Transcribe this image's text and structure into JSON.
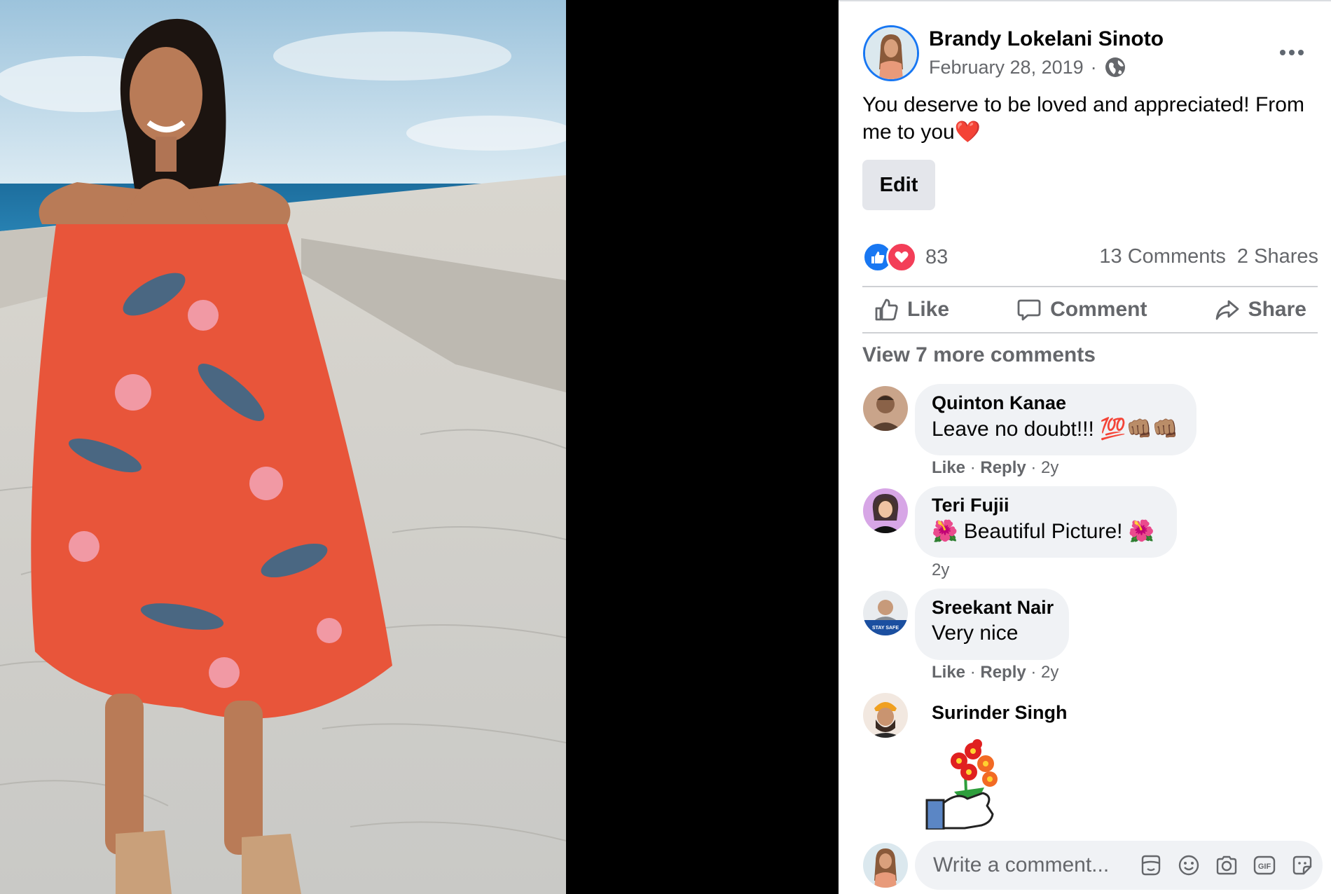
{
  "post": {
    "author": "Brandy Lokelani Sinoto",
    "date": "February 28, 2019",
    "date_separator": "·",
    "privacy_icon": "globe-icon",
    "text": "You deserve to be loved and appreciated! From me to you",
    "text_emoji": "❤️",
    "edit_label": "Edit",
    "more_icon": "more-horizontal-icon"
  },
  "reactions": {
    "count": "83",
    "comments": "13 Comments",
    "shares": "2 Shares"
  },
  "actions": {
    "like": "Like",
    "comment": "Comment",
    "share": "Share"
  },
  "view_more": "View 7 more comments",
  "comments": [
    {
      "name": "Quinton Kanae",
      "text": "Leave no doubt!!! ",
      "emoji": "💯👊🏽👊🏽",
      "like": "Like",
      "reply": "Reply",
      "time": "2y"
    },
    {
      "name": "Teri Fujii",
      "text_prefix_emoji": "🌺",
      "text": " Beautiful Picture! ",
      "emoji": "🌺",
      "time": "2y"
    },
    {
      "name": "Sreekant Nair",
      "text": "Very nice",
      "avatar_badge": "STAY SAFE",
      "like": "Like",
      "reply": "Reply",
      "time": "2y"
    },
    {
      "name": "Surinder Singh",
      "sticker": "hand-holding-flowers-sticker"
    }
  ],
  "composer": {
    "placeholder": "Write a comment...",
    "icons": [
      "avatar-sticker-icon",
      "emoji-icon",
      "camera-icon",
      "gif-icon",
      "sticker-icon"
    ]
  },
  "colors": {
    "brand_blue": "#1877f2",
    "love_red": "#f33e58",
    "muted_text": "#65676b",
    "bubble_bg": "#f0f2f5",
    "dress_orange": "#e8553a"
  }
}
